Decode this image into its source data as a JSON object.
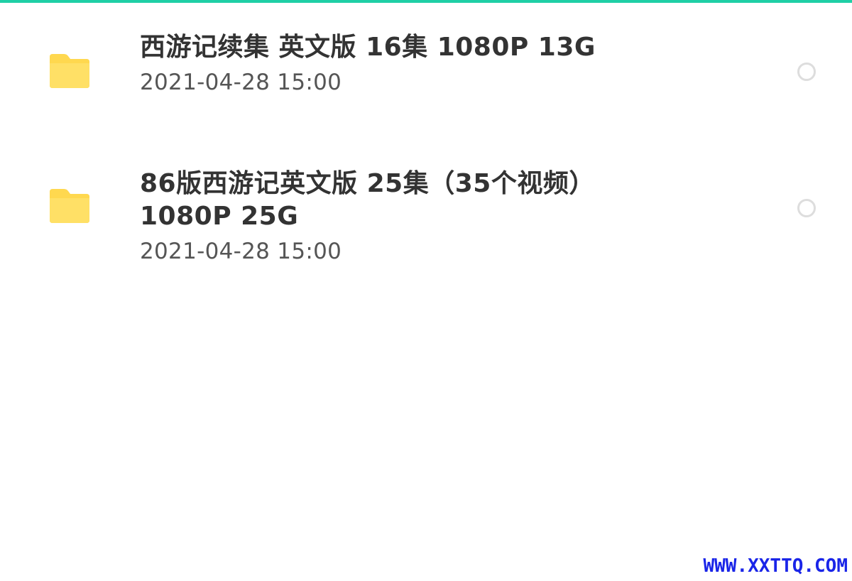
{
  "accent_color": "#1fcfa6",
  "folder_icon_color": "#ffd84f",
  "files": [
    {
      "icon": "folder-icon",
      "title": "西游记续集 英文版 16集 1080P 13G",
      "date": "2021-04-28 15:00",
      "selected": false
    },
    {
      "icon": "folder-icon",
      "title_line1": "86版西游记英文版 25集（35个视频）",
      "title_line2": "1080P 25G",
      "date": "2021-04-28 15:00",
      "selected": false
    }
  ],
  "watermark": "WWW.XXTTQ.COM"
}
